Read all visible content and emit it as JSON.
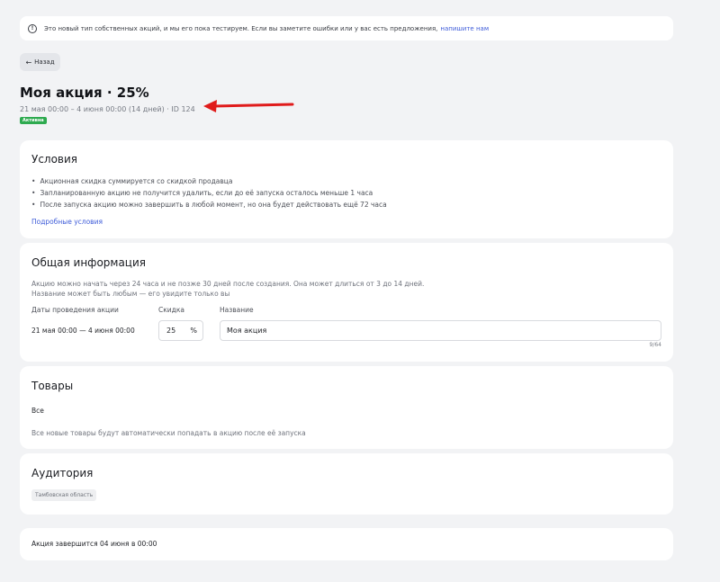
{
  "notice": {
    "text": "Это новый тип собственных акций, и мы его пока тестируем. Если вы заметите ошибки или у вас есть предложения,",
    "link": "напишите нам"
  },
  "header": {
    "back_label": "Назад",
    "title": "Моя акция · 25%",
    "meta": "21 мая 00:00 – 4 июня 00:00 (14 дней) · ID 124",
    "status": "Активна"
  },
  "conditions": {
    "title": "Условия",
    "items": [
      "Акционная скидка суммируется со скидкой продавца",
      "Запланированную акцию не получится удалить, если до её запуска осталось меньше 1 часа",
      "После запуска акцию можно завершить в любой момент, но она будет действовать ещё 72 часа"
    ],
    "details_link": "Подробные условия"
  },
  "general": {
    "title": "Общая информация",
    "desc_line1": "Акцию можно начать через 24 часа и не позже 30 дней после создания. Она может длиться от 3 до 14 дней.",
    "desc_line2": "Название может быть любым — его увидите только вы",
    "dates_label": "Даты проведения акции",
    "dates_value": "21 мая 00:00 — 4 июня 00:00",
    "discount_label": "Скидка",
    "discount_value": "25",
    "discount_unit": "%",
    "name_label": "Название",
    "name_value": "Моя акция",
    "char_count": "9/64"
  },
  "products": {
    "title": "Товары",
    "value": "Все",
    "note": "Все новые товары будут автоматически попадать в акцию после её запуска"
  },
  "audience": {
    "title": "Аудитория",
    "region": "Тамбовская область"
  },
  "footer": {
    "end_text": "Акция завершится 04 июня в 00:00"
  },
  "colors": {
    "accent": "#3d5bd9",
    "status_green": "#2eaa4f",
    "annotation_red": "#e01b1b"
  }
}
